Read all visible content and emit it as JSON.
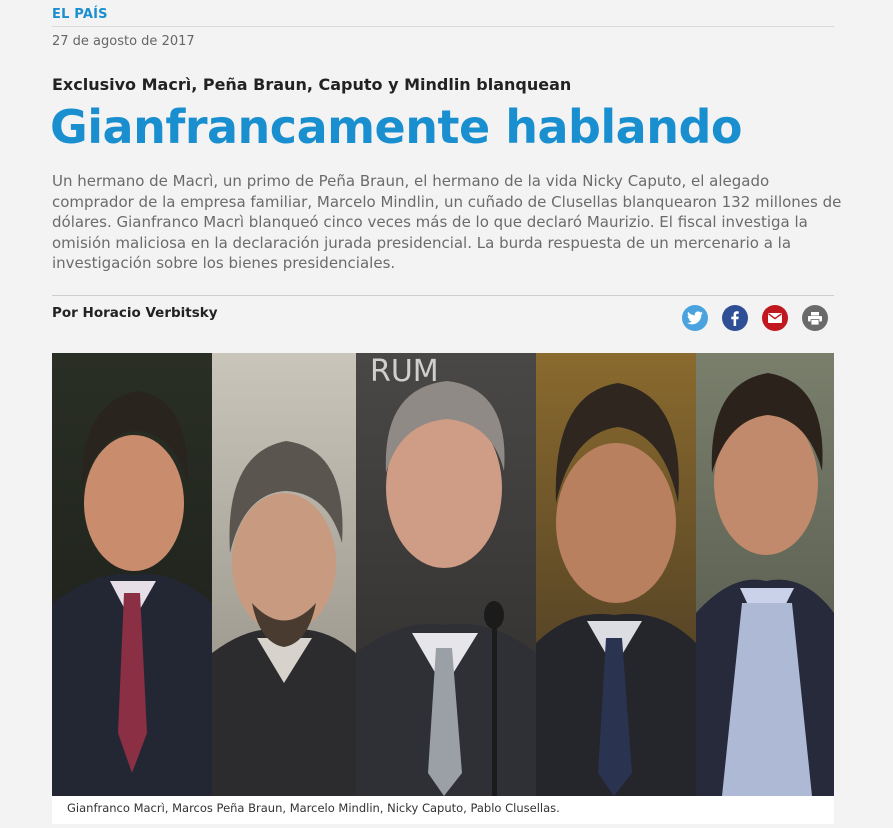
{
  "section": "EL PAÍS",
  "date": "27 de agosto de 2017",
  "kicker": "Exclusivo Macrì, Peña Braun, Caputo y Mindlin blanquean",
  "headline": "Gianfrancamente hablando",
  "summary": "Un hermano de Macrì, un primo de Peña Braun, el hermano de la vida Nicky Caputo, el alegado comprador de la empresa familiar, Marcelo Mindlin, un cuñado de Clusellas blanquearon 132 millones de dólares. Gianfranco Macrì blanqueó cinco veces más de lo que declaró Maurizio. El fiscal investiga la omisión maliciosa en la declaración jurada presidencial. La burda respuesta de un mercenario a la investigación sobre los bienes presidenciales.",
  "byline": "Por Horacio Verbitsky",
  "share": {
    "icons": [
      "twitter-icon",
      "facebook-icon",
      "mail-icon",
      "print-icon"
    ],
    "colors": {
      "twitter": "#4aa3df",
      "facebook": "#2e4f95",
      "mail": "#c0181e",
      "print": "#6a6a6a"
    }
  },
  "photo": {
    "backdrop_text": "RUM",
    "caption": "Gianfranco Macrì, Marcos Peña Braun, Marcelo Mindlin, Nicky Caputo, Pablo Clusellas."
  },
  "colors": {
    "accent": "#1a8fcf",
    "background": "#f3f3f3",
    "summary_text": "#6b6b6b"
  }
}
